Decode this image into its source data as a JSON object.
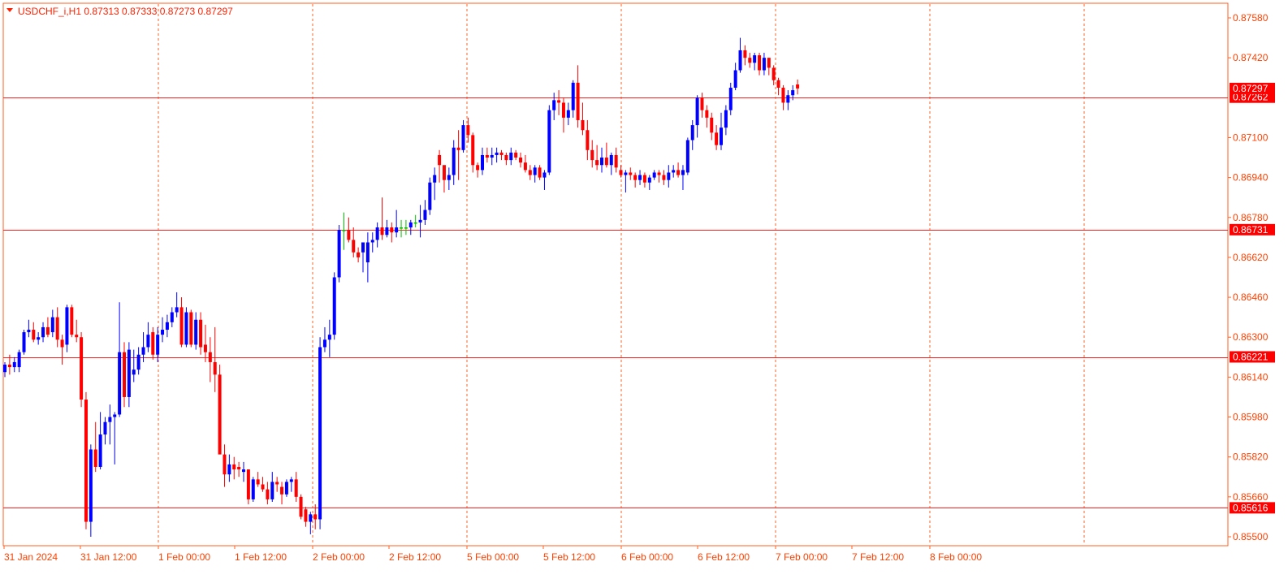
{
  "header": {
    "symbol_label": "USDCHF_i,H1  0.87313 0.87333 0.87273 0.87297"
  },
  "colors": {
    "bull": "#0000ff",
    "bear": "#ff0000",
    "doji": "#00c000",
    "frame": "#ff6020",
    "grid": "#ff6020",
    "level": "#ff2020",
    "badge_bg": "#ff0000",
    "badge_text": "#ffffff",
    "axis_text": "#ff4000"
  },
  "chart_data": {
    "type": "candlestick",
    "timeframe": "H1",
    "ylim": [
      0.8547,
      0.8762
    ],
    "price_ticks": [
      "0.87580",
      "0.87420",
      "0.87100",
      "0.86940",
      "0.86780",
      "0.86620",
      "0.86460",
      "0.86300",
      "0.86140",
      "0.85980",
      "0.85820",
      "0.85660",
      "0.85500"
    ],
    "time_labels": [
      "31 Jan 2024",
      "31 Jan 12:00",
      "1 Feb 00:00",
      "1 Feb 12:00",
      "2 Feb 00:00",
      "2 Feb 12:00",
      "5 Feb 00:00",
      "5 Feb 12:00",
      "6 Feb 00:00",
      "6 Feb 12:00",
      "7 Feb 00:00",
      "7 Feb 12:00",
      "8 Feb 00:00"
    ],
    "horizontal_levels": [
      {
        "price": 0.87262,
        "label": "0.87262"
      },
      {
        "price": 0.86731,
        "label": "0.86731"
      },
      {
        "price": 0.86221,
        "label": "0.86221"
      },
      {
        "price": 0.85616,
        "label": "0.85616"
      }
    ],
    "current_price": {
      "price": 0.87297,
      "label": "0.87297"
    },
    "candles": [
      [
        0.8616,
        0.862,
        0.8614,
        0.8619
      ],
      [
        0.8619,
        0.8623,
        0.8615,
        0.8618
      ],
      [
        0.8618,
        0.8622,
        0.8616,
        0.862
      ],
      [
        0.8618,
        0.8625,
        0.8616,
        0.8624
      ],
      [
        0.8624,
        0.8633,
        0.8623,
        0.8632
      ],
      [
        0.8632,
        0.8637,
        0.863,
        0.8633
      ],
      [
        0.8633,
        0.8636,
        0.8628,
        0.8629
      ],
      [
        0.8629,
        0.8632,
        0.8627,
        0.863
      ],
      [
        0.863,
        0.8636,
        0.8628,
        0.8634
      ],
      [
        0.8634,
        0.8638,
        0.863,
        0.8631
      ],
      [
        0.8632,
        0.8641,
        0.863,
        0.8638
      ],
      [
        0.8638,
        0.8642,
        0.8626,
        0.8629
      ],
      [
        0.8629,
        0.8631,
        0.8619,
        0.8626
      ],
      [
        0.8627,
        0.8643,
        0.8624,
        0.8642
      ],
      [
        0.8642,
        0.8643,
        0.863,
        0.8631
      ],
      [
        0.8631,
        0.8637,
        0.8628,
        0.863
      ],
      [
        0.863,
        0.8632,
        0.8602,
        0.8605
      ],
      [
        0.8605,
        0.8608,
        0.8553,
        0.8556
      ],
      [
        0.8556,
        0.8587,
        0.855,
        0.8585
      ],
      [
        0.8585,
        0.8596,
        0.8576,
        0.8578
      ],
      [
        0.8578,
        0.86,
        0.8577,
        0.8591
      ],
      [
        0.8591,
        0.8598,
        0.8587,
        0.8596
      ],
      [
        0.8596,
        0.8603,
        0.8587,
        0.8598
      ],
      [
        0.8598,
        0.86,
        0.8579,
        0.8599
      ],
      [
        0.8599,
        0.8644,
        0.8598,
        0.8624
      ],
      [
        0.8624,
        0.8628,
        0.8602,
        0.8606
      ],
      [
        0.8606,
        0.8628,
        0.8602,
        0.8625
      ],
      [
        0.8615,
        0.8625,
        0.8612,
        0.8617
      ],
      [
        0.8617,
        0.8626,
        0.8615,
        0.8623
      ],
      [
        0.8623,
        0.8632,
        0.862,
        0.8626
      ],
      [
        0.8626,
        0.8636,
        0.8624,
        0.8631
      ],
      [
        0.8632,
        0.8634,
        0.8621,
        0.8623
      ],
      [
        0.8623,
        0.8634,
        0.862,
        0.8631
      ],
      [
        0.8631,
        0.8638,
        0.8628,
        0.8633
      ],
      [
        0.8633,
        0.8639,
        0.863,
        0.8636
      ],
      [
        0.8636,
        0.8642,
        0.8634,
        0.864
      ],
      [
        0.864,
        0.8648,
        0.8638,
        0.8642
      ],
      [
        0.8642,
        0.8646,
        0.8626,
        0.8627
      ],
      [
        0.8627,
        0.8642,
        0.8626,
        0.864
      ],
      [
        0.864,
        0.8641,
        0.8626,
        0.8627
      ],
      [
        0.8627,
        0.864,
        0.8625,
        0.8637
      ],
      [
        0.8637,
        0.864,
        0.8623,
        0.8626
      ],
      [
        0.8627,
        0.8635,
        0.862,
        0.8624
      ],
      [
        0.8624,
        0.863,
        0.8612,
        0.862
      ],
      [
        0.862,
        0.8634,
        0.8608,
        0.8615
      ],
      [
        0.8615,
        0.8619,
        0.8585,
        0.8583
      ],
      [
        0.8583,
        0.8587,
        0.857,
        0.8575
      ],
      [
        0.8575,
        0.8583,
        0.8572,
        0.8579
      ],
      [
        0.8579,
        0.8582,
        0.8573,
        0.8577
      ],
      [
        0.8578,
        0.858,
        0.8574,
        0.8577
      ],
      [
        0.8576,
        0.858,
        0.8572,
        0.8577
      ],
      [
        0.8577,
        0.8577,
        0.8563,
        0.8565
      ],
      [
        0.8565,
        0.8574,
        0.8564,
        0.8573
      ],
      [
        0.8573,
        0.8576,
        0.857,
        0.8571
      ],
      [
        0.8571,
        0.8574,
        0.8568,
        0.8569
      ],
      [
        0.8569,
        0.8572,
        0.8563,
        0.8565
      ],
      [
        0.8565,
        0.8576,
        0.8564,
        0.8572
      ],
      [
        0.8572,
        0.8574,
        0.8568,
        0.8571
      ],
      [
        0.857,
        0.8572,
        0.8563,
        0.8567
      ],
      [
        0.8567,
        0.8573,
        0.8566,
        0.8572
      ],
      [
        0.8572,
        0.8574,
        0.8568,
        0.8573
      ],
      [
        0.8573,
        0.8576,
        0.8564,
        0.8566
      ],
      [
        0.8566,
        0.8567,
        0.8557,
        0.8558
      ],
      [
        0.8561,
        0.8562,
        0.8554,
        0.8556
      ],
      [
        0.8556,
        0.856,
        0.8551,
        0.8559
      ],
      [
        0.8559,
        0.8563,
        0.8553,
        0.8557
      ],
      [
        0.8557,
        0.863,
        0.8553,
        0.8626
      ],
      [
        0.8626,
        0.8634,
        0.8624,
        0.8629
      ],
      [
        0.8629,
        0.8637,
        0.8622,
        0.8631
      ],
      [
        0.8631,
        0.8656,
        0.8629,
        0.8654
      ],
      [
        0.8654,
        0.8675,
        0.8652,
        0.8673
      ],
      [
        0.8673,
        0.868,
        0.8665,
        0.8673
      ],
      [
        0.8673,
        0.8678,
        0.8668,
        0.8669
      ],
      [
        0.8669,
        0.8674,
        0.8662,
        0.8664
      ],
      [
        0.8664,
        0.8666,
        0.866,
        0.8662
      ],
      [
        0.8664,
        0.8666,
        0.8656,
        0.8668
      ],
      [
        0.866,
        0.8672,
        0.8652,
        0.8668
      ],
      [
        0.8668,
        0.8672,
        0.8664,
        0.8669
      ],
      [
        0.8669,
        0.8676,
        0.8666,
        0.8674
      ],
      [
        0.8674,
        0.8686,
        0.8669,
        0.8671
      ],
      [
        0.8671,
        0.8677,
        0.867,
        0.8674
      ],
      [
        0.8674,
        0.8676,
        0.8668,
        0.8672
      ],
      [
        0.8672,
        0.8681,
        0.867,
        0.8674
      ],
      [
        0.8674,
        0.8677,
        0.867,
        0.8674
      ],
      [
        0.8674,
        0.8677,
        0.8671,
        0.8674
      ],
      [
        0.8674,
        0.8677,
        0.8671,
        0.8676
      ],
      [
        0.8676,
        0.8679,
        0.8674,
        0.8676
      ],
      [
        0.8676,
        0.8683,
        0.867,
        0.8677
      ],
      [
        0.8677,
        0.8685,
        0.8675,
        0.8681
      ],
      [
        0.8681,
        0.8694,
        0.8679,
        0.8692
      ],
      [
        0.8692,
        0.8698,
        0.8685,
        0.8695
      ],
      [
        0.8703,
        0.8705,
        0.8692,
        0.8699
      ],
      [
        0.8699,
        0.8696,
        0.8688,
        0.8693
      ],
      [
        0.8693,
        0.8698,
        0.8689,
        0.8695
      ],
      [
        0.8695,
        0.8709,
        0.8691,
        0.8706
      ],
      [
        0.8706,
        0.8713,
        0.8693,
        0.8705
      ],
      [
        0.8705,
        0.8717,
        0.8704,
        0.8715
      ],
      [
        0.8715,
        0.8718,
        0.8708,
        0.8711
      ],
      [
        0.8711,
        0.8712,
        0.8696,
        0.8699
      ],
      [
        0.8699,
        0.87,
        0.8694,
        0.8697
      ],
      [
        0.8697,
        0.8706,
        0.8695,
        0.8703
      ],
      [
        0.8703,
        0.8706,
        0.87,
        0.8702
      ],
      [
        0.8702,
        0.8706,
        0.8699,
        0.8703
      ],
      [
        0.8703,
        0.8706,
        0.87,
        0.8704
      ],
      [
        0.8704,
        0.8705,
        0.8701,
        0.8703
      ],
      [
        0.8703,
        0.8704,
        0.8699,
        0.8701
      ],
      [
        0.8701,
        0.8706,
        0.8699,
        0.8704
      ],
      [
        0.8704,
        0.8705,
        0.8701,
        0.8702
      ],
      [
        0.8702,
        0.8704,
        0.8698,
        0.87
      ],
      [
        0.87,
        0.8703,
        0.8696,
        0.8697
      ],
      [
        0.8697,
        0.8699,
        0.8693,
        0.8695
      ],
      [
        0.8695,
        0.8699,
        0.8692,
        0.8698
      ],
      [
        0.8698,
        0.8699,
        0.8693,
        0.8694
      ],
      [
        0.8694,
        0.8697,
        0.8689,
        0.8696
      ],
      [
        0.8696,
        0.8723,
        0.8695,
        0.8721
      ],
      [
        0.8721,
        0.8728,
        0.8717,
        0.8725
      ],
      [
        0.8725,
        0.8729,
        0.8719,
        0.8724
      ],
      [
        0.8724,
        0.8726,
        0.8712,
        0.8718
      ],
      [
        0.8718,
        0.8724,
        0.8715,
        0.8721
      ],
      [
        0.8721,
        0.8733,
        0.8718,
        0.8732
      ],
      [
        0.8732,
        0.8739,
        0.8714,
        0.8717
      ],
      [
        0.8717,
        0.8724,
        0.8711,
        0.8713
      ],
      [
        0.8713,
        0.8717,
        0.8701,
        0.8705
      ],
      [
        0.8705,
        0.8709,
        0.8698,
        0.8701
      ],
      [
        0.8701,
        0.8707,
        0.8697,
        0.8699
      ],
      [
        0.8699,
        0.8706,
        0.8696,
        0.8702
      ],
      [
        0.8702,
        0.8708,
        0.8698,
        0.8699
      ],
      [
        0.8699,
        0.8704,
        0.8695,
        0.8703
      ],
      [
        0.8703,
        0.8706,
        0.8696,
        0.8698
      ],
      [
        0.8697,
        0.8699,
        0.8694,
        0.8695
      ],
      [
        0.8695,
        0.8697,
        0.8688,
        0.8696
      ],
      [
        0.8696,
        0.8698,
        0.8693,
        0.8695
      ],
      [
        0.8695,
        0.8696,
        0.869,
        0.8693
      ],
      [
        0.8693,
        0.8697,
        0.8691,
        0.8695
      ],
      [
        0.8695,
        0.8696,
        0.869,
        0.8692
      ],
      [
        0.8692,
        0.8695,
        0.8689,
        0.8694
      ],
      [
        0.8694,
        0.8697,
        0.8693,
        0.8696
      ],
      [
        0.8696,
        0.8697,
        0.8692,
        0.8695
      ],
      [
        0.8695,
        0.8697,
        0.8691,
        0.8693
      ],
      [
        0.8693,
        0.8699,
        0.869,
        0.8696
      ],
      [
        0.8696,
        0.8699,
        0.8694,
        0.8697
      ],
      [
        0.8697,
        0.87,
        0.8694,
        0.8695
      ],
      [
        0.8695,
        0.8699,
        0.8689,
        0.8697
      ],
      [
        0.8696,
        0.871,
        0.8695,
        0.8709
      ],
      [
        0.8709,
        0.8717,
        0.8705,
        0.8715
      ],
      [
        0.8715,
        0.8727,
        0.871,
        0.8726
      ],
      [
        0.8726,
        0.8728,
        0.8718,
        0.8721
      ],
      [
        0.8721,
        0.8723,
        0.8714,
        0.8718
      ],
      [
        0.8718,
        0.872,
        0.8709,
        0.8712
      ],
      [
        0.8712,
        0.8715,
        0.8705,
        0.8707
      ],
      [
        0.8707,
        0.872,
        0.8705,
        0.8714
      ],
      [
        0.8714,
        0.8723,
        0.8711,
        0.8721
      ],
      [
        0.8721,
        0.8732,
        0.8719,
        0.873
      ],
      [
        0.873,
        0.874,
        0.8729,
        0.8737
      ],
      [
        0.8737,
        0.875,
        0.8736,
        0.8745
      ],
      [
        0.8745,
        0.8747,
        0.8739,
        0.8742
      ],
      [
        0.8742,
        0.8744,
        0.8738,
        0.874
      ],
      [
        0.874,
        0.8744,
        0.8737,
        0.8743
      ],
      [
        0.8743,
        0.8744,
        0.8735,
        0.8737
      ],
      [
        0.8737,
        0.8744,
        0.8735,
        0.8742
      ],
      [
        0.8742,
        0.8742,
        0.8735,
        0.8738
      ],
      [
        0.8738,
        0.8739,
        0.8731,
        0.8733
      ],
      [
        0.8733,
        0.8734,
        0.8727,
        0.873
      ],
      [
        0.873,
        0.8731,
        0.8721,
        0.8724
      ],
      [
        0.8724,
        0.8729,
        0.8721,
        0.8727
      ],
      [
        0.8727,
        0.8731,
        0.8725,
        0.8729
      ],
      [
        0.87313,
        0.87333,
        0.87273,
        0.87297
      ]
    ]
  }
}
